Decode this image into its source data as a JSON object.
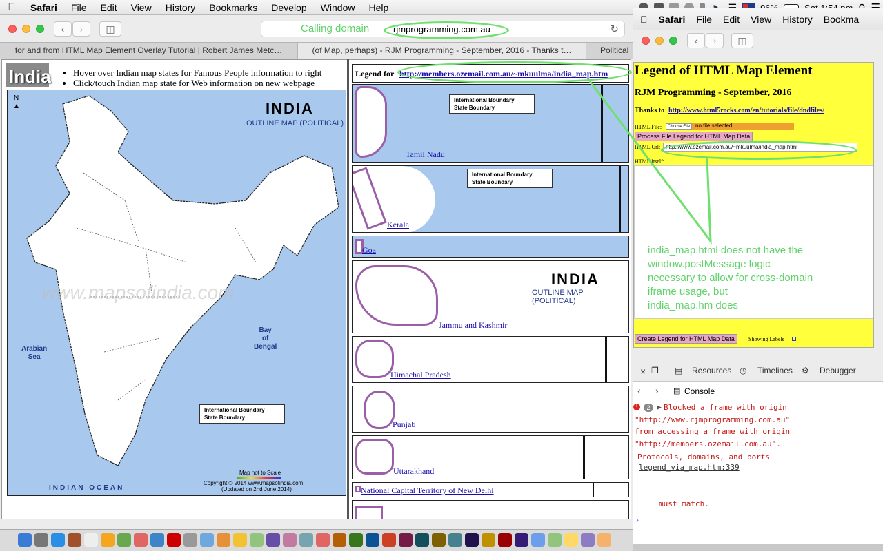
{
  "menubar": {
    "app": "Safari",
    "items": [
      "File",
      "Edit",
      "View",
      "History",
      "Bookmarks",
      "Develop",
      "Window",
      "Help"
    ],
    "battery": "96%",
    "clock": "Sat 1:54 pm"
  },
  "left_window": {
    "url": "rjmprogramming.com.au",
    "annotation": "Calling domain",
    "tabs": [
      "for and from HTML Map Element Overlay Tutorial | Robert James Metc…",
      "(of Map, perhaps) - RJM Programming - September, 2016 - Thanks t…",
      "Political"
    ],
    "page": {
      "title_badge": "India",
      "instructions": [
        "Hover over Indian map states for Famous People information to right",
        "Click/touch Indian map state for Web information on new webpage"
      ],
      "map": {
        "north": "N",
        "heading": "INDIA",
        "subheading": "OUTLINE MAP (POLITICAL)",
        "arabian_sea": [
          "Arabian",
          "Sea"
        ],
        "bay_of_bengal": [
          "Bay",
          "of",
          "Bengal"
        ],
        "indian_ocean": "INDIAN OCEAN",
        "legend_intl": "International Boundary",
        "legend_state": "State Boundary",
        "not_to_scale": "Map not to Scale",
        "copyright": "Copyright © 2014 www.mapsofindia.com",
        "updated": "(Updated on 2nd June 2014)",
        "watermark": "www.mapsofindia.com"
      },
      "legend_title_prefix": "Legend for",
      "legend_url": "http://members.ozemail.com.au/~mkuulma/india_map.htm",
      "legend_items": [
        "Tamil Nadu",
        "Kerala",
        "Goa",
        "Jammu and Kashmir",
        "Himachal Pradesh",
        "Punjab",
        "Uttarakhand",
        "National Capital Territory of New Delhi"
      ]
    }
  },
  "right_window": {
    "menu": [
      "Safari",
      "File",
      "Edit",
      "View",
      "History",
      "Bookma"
    ],
    "page": {
      "heading": "Legend of HTML Map Element",
      "subheading": "RJM Programming - September, 2016",
      "thanks_prefix": "Thanks to",
      "thanks_link": "http://www.html5rocks.com/en/tutorials/file/dndfiles/",
      "html_file_label": "HTML File:",
      "choose_file": "Choose File",
      "no_file": "no file selected",
      "process_button": "Process File Legend for HTML Map Data",
      "html_url_label": "HTML Url:",
      "html_url_value": "http://www.ozemail.com.au/~mkuulma/india_map.html",
      "html_itself_label": "HTML Itself:",
      "create_button": "Create Legend for HTML Map Data",
      "showing_labels": "Showing Labels"
    },
    "annotation": [
      "india_map.html does not have the",
      "window.postMessage logic",
      "necessary to allow for cross-domain",
      "iframe usage, but",
      "india_map.hm does"
    ],
    "devtools": {
      "tabs": [
        "Resources",
        "Timelines",
        "Debugger"
      ],
      "console_label": "Console",
      "error_count": "2",
      "lines": [
        "Blocked a frame with origin",
        "\"http://www.rjmprogramming.com.au\"",
        "from accessing a frame with origin",
        "\"http://members.ozemail.com.au\".",
        "Protocols, domains, and ports",
        "must match."
      ],
      "source": "legend_via_map.htm:339"
    }
  },
  "colors": {
    "annotation_green": "#6fe06e",
    "highlight_yellow": "#ffff3c"
  }
}
